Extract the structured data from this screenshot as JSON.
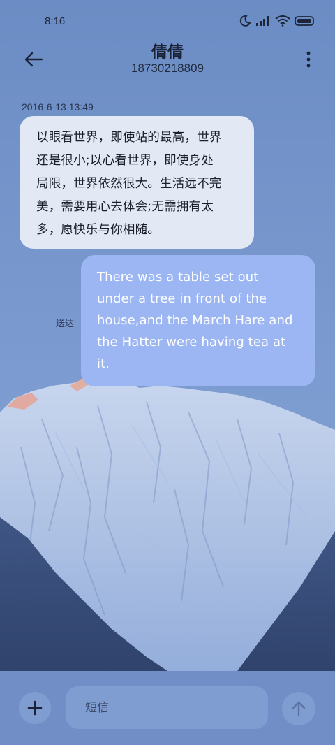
{
  "status_bar": {
    "time": "8:16",
    "icons": [
      "moon-icon",
      "signal-icon",
      "wifi-icon",
      "battery-icon"
    ]
  },
  "header": {
    "contact_name": "倩倩",
    "contact_number": "18730218809",
    "back_icon": "back-arrow-icon",
    "more_icon": "more-vertical-icon"
  },
  "conversation": {
    "timestamp": "2016-6-13 13:49",
    "messages": [
      {
        "direction": "incoming",
        "lines": [
          "以眼看世界，即使站的最高，世界",
          "还是很小;以心看世界，即使身处",
          "局限，世界依然很大。生活远不完",
          "美，需要用心去体会;无需拥有太",
          "多，愿快乐与你相随。"
        ]
      },
      {
        "direction": "outgoing",
        "lines": [
          "There was a table set out",
          "under a tree in front of the",
          "house,and the March Hare and",
          "the Hatter were having tea at",
          "it."
        ],
        "status": "送达"
      }
    ]
  },
  "composer": {
    "placeholder": "短信",
    "value": "",
    "add_icon": "plus-icon",
    "send_icon": "arrow-up-icon"
  },
  "colors": {
    "incoming_bubble": "#e3e9f4",
    "outgoing_bubble": "#9bb6f3",
    "background": "#7a98cc"
  }
}
